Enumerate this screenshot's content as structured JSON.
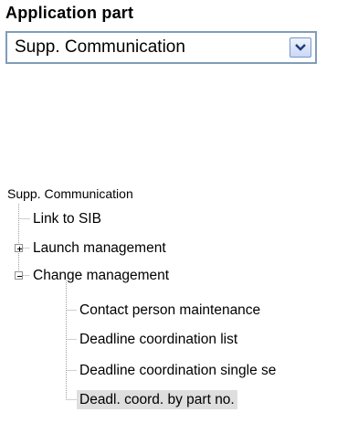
{
  "header": {
    "title": "Application part"
  },
  "app_select": {
    "value": "Supp. Communication"
  },
  "icons": {
    "dropdown": "chevron-down-icon",
    "expand": "plus-box-icon",
    "collapse": "minus-box-icon"
  },
  "tree": {
    "root_label": "Supp. Communication",
    "link_sib": "Link to SIB",
    "launch_management": "Launch management",
    "change_management": "Change management",
    "children": [
      "Contact person maintenance",
      "Deadline coordination list",
      "Deadline coordination single se",
      "Deadl. coord. by part no."
    ]
  },
  "colors": {
    "selected_bg": "#dedede",
    "select_border": "#7f9db9",
    "tree_line": "#a0a0a0"
  }
}
